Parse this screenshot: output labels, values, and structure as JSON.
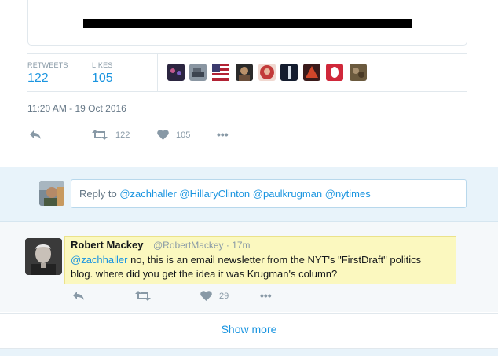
{
  "stats": {
    "retweets_label": "RETWEETS",
    "retweets_value": "122",
    "likes_label": "LIKES",
    "likes_value": "105"
  },
  "likers": [
    {
      "name": "liker-avatar-1",
      "color": "#2b2540"
    },
    {
      "name": "liker-avatar-2",
      "color": "#5b6470"
    },
    {
      "name": "liker-avatar-3",
      "color": "#b22234"
    },
    {
      "name": "liker-avatar-4",
      "color": "#6a4e3a"
    },
    {
      "name": "liker-avatar-5",
      "color": "#c23a3a"
    },
    {
      "name": "liker-avatar-6",
      "color": "#141c2e"
    },
    {
      "name": "liker-avatar-7",
      "color": "#3a1a1a"
    },
    {
      "name": "liker-avatar-8",
      "color": "#d0283a"
    },
    {
      "name": "liker-avatar-9",
      "color": "#6b5a3e"
    }
  ],
  "timestamp": "11:20 AM - 19 Oct 2016",
  "actions": {
    "retweet_count": "122",
    "like_count": "105",
    "more": "•••"
  },
  "reply_box": {
    "prefix": "Reply to",
    "mentions": "@zachhaller @HillaryClinton @paulkrugman @nytimes"
  },
  "reply_tweet": {
    "fullname": "Robert Mackey",
    "handle": "@RobertMackey · 17m",
    "mention": "@zachhaller",
    "text_line1": " no, this is an email newsletter from the NYT's \"FirstDraft\" politics",
    "text_line2": "blog. where did you get the idea it was Krugman's column?",
    "like_count": "29",
    "more": "•••"
  },
  "show_more": "Show more",
  "colors": {
    "accent": "#1b95e0",
    "highlight": "#fbf8bf",
    "reply_band": "#e8f3fa",
    "muted": "#8899a6"
  }
}
